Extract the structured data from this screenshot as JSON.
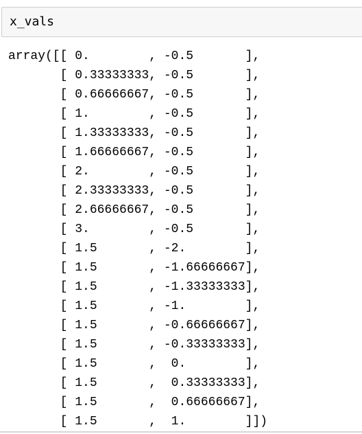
{
  "input": {
    "code": "x_vals"
  },
  "output": {
    "lines": [
      "array([[ 0.        , -0.5       ],",
      "       [ 0.33333333, -0.5       ],",
      "       [ 0.66666667, -0.5       ],",
      "       [ 1.        , -0.5       ],",
      "       [ 1.33333333, -0.5       ],",
      "       [ 1.66666667, -0.5       ],",
      "       [ 2.        , -0.5       ],",
      "       [ 2.33333333, -0.5       ],",
      "       [ 2.66666667, -0.5       ],",
      "       [ 3.        , -0.5       ],",
      "       [ 1.5       , -2.        ],",
      "       [ 1.5       , -1.66666667],",
      "       [ 1.5       , -1.33333333],",
      "       [ 1.5       , -1.        ],",
      "       [ 1.5       , -0.66666667],",
      "       [ 1.5       , -0.33333333],",
      "       [ 1.5       ,  0.        ],",
      "       [ 1.5       ,  0.33333333],",
      "       [ 1.5       ,  0.66666667],",
      "       [ 1.5       ,  1.        ]])"
    ]
  },
  "colors": {
    "input_background": "#f7f7f7",
    "input_border": "#cfcfcf",
    "text": "#000000"
  }
}
